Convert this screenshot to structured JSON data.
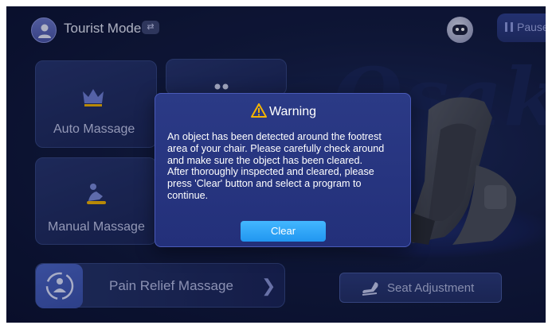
{
  "header": {
    "mode_label": "Tourist Mode",
    "mode_toggle_glyph": "⇄",
    "pause_label": "Pause"
  },
  "brand": {
    "watermark": "Osaki"
  },
  "tiles": {
    "auto_massage": "Auto Massage",
    "manual_massage": "Manual Massage"
  },
  "pain_relief": {
    "label": "Pain Relief Massage"
  },
  "seat_adjustment": {
    "label": "Seat Adjustment"
  },
  "dialog": {
    "title": "Warning",
    "body_lines": [
      "An object has been detected around the footrest",
      "area of your chair. Please carefully check around",
      "and make sure the object has been cleared.",
      "After thoroughly inspected and cleared, please",
      "press 'Clear' button and select a program to",
      "continue."
    ],
    "clear_label": "Clear"
  },
  "colors": {
    "background": "#121b3f",
    "dialog": "#2b3a86",
    "accent": "#2196f0",
    "warning": "#f5b400"
  }
}
